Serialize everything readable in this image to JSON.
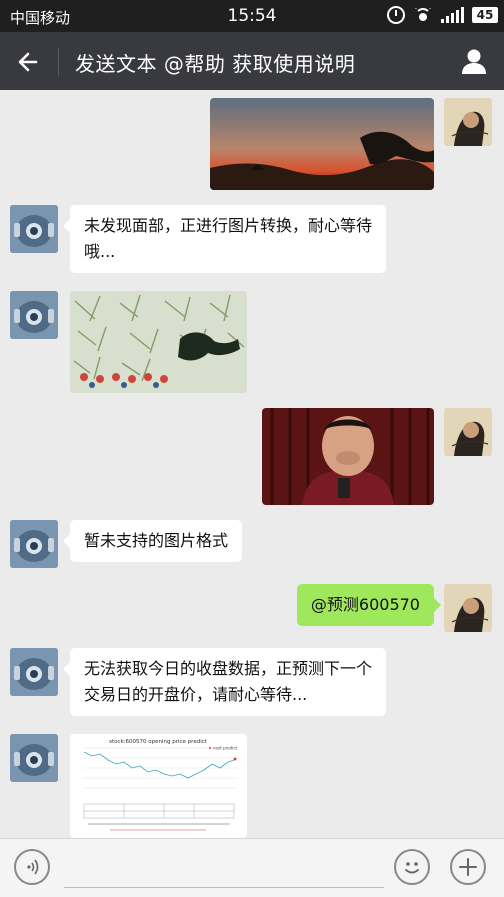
{
  "status_bar": {
    "carrier": "中国移动",
    "time": "15:54",
    "battery": "45"
  },
  "header": {
    "title": "发送文本 @帮助 获取使用说明"
  },
  "messages": [
    {
      "from": "user",
      "type": "image",
      "content": "dragon landscape image"
    },
    {
      "from": "bot",
      "type": "text",
      "text": "未发现面部，正进行图片转换，耐心等待哦..."
    },
    {
      "from": "bot",
      "type": "image",
      "content": "stylized converted image"
    },
    {
      "from": "user",
      "type": "image",
      "content": "man portrait image"
    },
    {
      "from": "bot",
      "type": "text",
      "text": "暂未支持的图片格式"
    },
    {
      "from": "user",
      "type": "text",
      "text": "@预测600570"
    },
    {
      "from": "bot",
      "type": "text",
      "text": "无法获取今日的收盘数据，正预测下一个交易日的开盘价，请耐心等待..."
    },
    {
      "from": "bot",
      "type": "image",
      "content": "stock chart image"
    }
  ],
  "chart_preview": {
    "title": "stock:600570 opening price predict",
    "legend": "next predict"
  },
  "colors": {
    "titlebar": "#393a3f",
    "statusbar": "#1f1f1f",
    "chat_bg": "#ebebeb",
    "out_bubble": "#9fe75b",
    "in_bubble": "#ffffff"
  }
}
